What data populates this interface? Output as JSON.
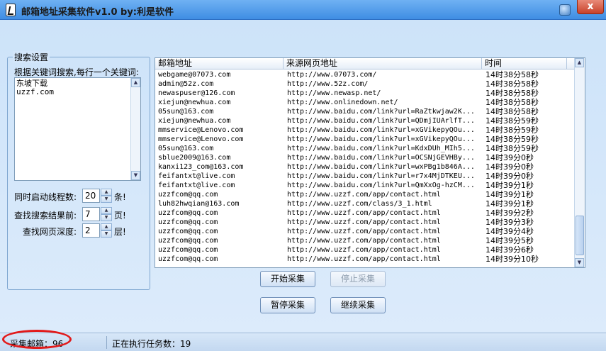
{
  "window": {
    "title": "邮箱地址采集软件v1.0  by:利是软件",
    "close_label": "x"
  },
  "search_settings": {
    "legend": "搜索设置",
    "keyword_label": "根据关键词搜索,每行一个关键词:",
    "keywords_text": "东坡下载\nuzzf.com",
    "threads_label": "同时启动线程数:",
    "threads_value": "20",
    "threads_suffix": "条!",
    "pages_label": "查找搜索结果前:",
    "pages_value": "7",
    "pages_suffix": "页!",
    "depth_label": "查找网页深度:",
    "depth_value": "2",
    "depth_suffix": "层!"
  },
  "table": {
    "headers": [
      "邮箱地址",
      "来源网页地址",
      "时间"
    ],
    "rows": [
      {
        "email": "webgame@07073.com",
        "url": "http://www.07073.com/",
        "time": "14时38分58秒"
      },
      {
        "email": "admin@52z.com",
        "url": "http://www.52z.com/",
        "time": "14时38分58秒"
      },
      {
        "email": "newaspuser@126.com",
        "url": "http://www.newasp.net/",
        "time": "14时38分58秒"
      },
      {
        "email": "xiejun@newhua.com",
        "url": "http://www.onlinedown.net/",
        "time": "14时38分58秒"
      },
      {
        "email": "05sun@163.com",
        "url": "http://www.baidu.com/link?url=RaZtkwjaw2K...",
        "time": "14时38分58秒"
      },
      {
        "email": "xiejun@newhua.com",
        "url": "http://www.baidu.com/link?url=QDmjIUArlfT...",
        "time": "14时38分59秒"
      },
      {
        "email": "mmservice@Lenovo.com",
        "url": "http://www.baidu.com/link?url=xGVikepyQOu...",
        "time": "14时38分59秒"
      },
      {
        "email": "mmservice@Lenovo.com",
        "url": "http://www.baidu.com/link?url=xGVikepyQOu...",
        "time": "14时38分59秒"
      },
      {
        "email": "05sun@163.com",
        "url": "http://www.baidu.com/link?url=KdxDUh_MIh5...",
        "time": "14时38分59秒"
      },
      {
        "email": "sblue2009@163.com",
        "url": "http://www.baidu.com/link?url=OCSNjGEVHBy...",
        "time": "14时39分0秒"
      },
      {
        "email": "kanxi123_com@163.com",
        "url": "http://www.baidu.com/link?url=wxPBg1b846A...",
        "time": "14时39分0秒"
      },
      {
        "email": "feifantxt@live.com",
        "url": "http://www.baidu.com/link?url=r7x4MjDTKEU...",
        "time": "14时39分0秒"
      },
      {
        "email": "feifantxt@live.com",
        "url": "http://www.baidu.com/link?url=QmXxOg-hzCM...",
        "time": "14时39分1秒"
      },
      {
        "email": "uzzfcom@qq.com",
        "url": "http://www.uzzf.com/app/contact.html",
        "time": "14时39分1秒"
      },
      {
        "email": "luh82hwqian@163.com",
        "url": "http://www.uzzf.com/class/3_1.html",
        "time": "14时39分1秒"
      },
      {
        "email": "uzzfcom@qq.com",
        "url": "http://www.uzzf.com/app/contact.html",
        "time": "14时39分2秒"
      },
      {
        "email": "uzzfcom@qq.com",
        "url": "http://www.uzzf.com/app/contact.html",
        "time": "14时39分3秒"
      },
      {
        "email": "uzzfcom@qq.com",
        "url": "http://www.uzzf.com/app/contact.html",
        "time": "14时39分4秒"
      },
      {
        "email": "uzzfcom@qq.com",
        "url": "http://www.uzzf.com/app/contact.html",
        "time": "14时39分5秒"
      },
      {
        "email": "uzzfcom@qq.com",
        "url": "http://www.uzzf.com/app/contact.html",
        "time": "14时39分6秒"
      },
      {
        "email": "uzzfcom@qq.com",
        "url": "http://www.uzzf.com/app/contact.html",
        "time": "14时39分10秒"
      }
    ]
  },
  "buttons": {
    "start": "开始采集",
    "stop": "停止采集",
    "pause": "暂停采集",
    "resume": "继续采集"
  },
  "status": {
    "collected": "采集邮箱：96",
    "running": "正在执行任务数：19"
  },
  "colors": {
    "highlight": "#e21a1a",
    "titlebar": "#4a95e6"
  }
}
